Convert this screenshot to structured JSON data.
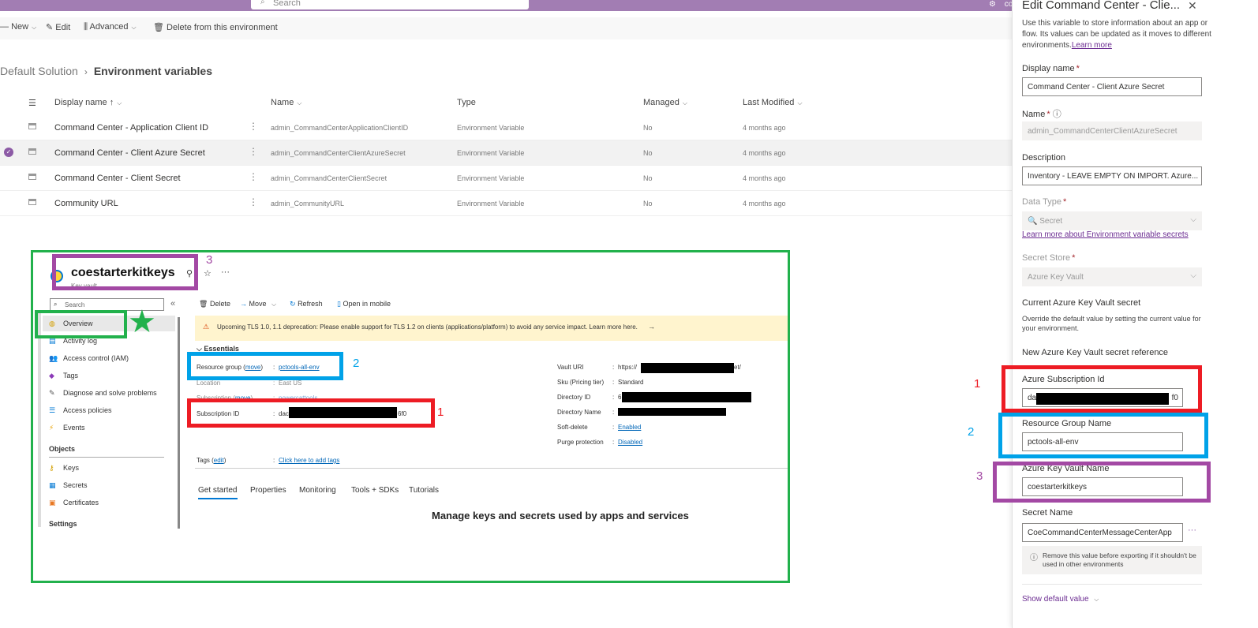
{
  "topbar": {
    "search_placeholder": "Search",
    "user_text": "coe-c"
  },
  "toolbar": {
    "new": "New",
    "edit": "Edit",
    "advanced": "Advanced",
    "delete": "Delete from this environment"
  },
  "breadcrumb": {
    "parent": "Default Solution",
    "current": "Environment variables"
  },
  "grid": {
    "headers": {
      "display_name": "Display name",
      "sort_arrow": "↑",
      "name": "Name",
      "type": "Type",
      "managed": "Managed",
      "last_modified": "Last Modified"
    },
    "rows": [
      {
        "display": "Command Center - Application Client ID",
        "name": "admin_CommandCenterApplicationClientID",
        "type": "Environment Variable",
        "managed": "No",
        "modified": "4 months ago"
      },
      {
        "display": "Command Center - Client Azure Secret",
        "name": "admin_CommandCenterClientAzureSecret",
        "type": "Environment Variable",
        "managed": "No",
        "modified": "4 months ago"
      },
      {
        "display": "Command Center - Client Secret",
        "name": "admin_CommandCenterClientSecret",
        "type": "Environment Variable",
        "managed": "No",
        "modified": "4 months ago"
      },
      {
        "display": "Community URL",
        "name": "admin_CommunityURL",
        "type": "Environment Variable",
        "managed": "No",
        "modified": "4 months ago"
      }
    ]
  },
  "azure": {
    "title": "coestarterkitkeys",
    "subtitle": "Key vault",
    "search_placeholder": "Search",
    "nav": [
      "Overview",
      "Activity log",
      "Access control (IAM)",
      "Tags",
      "Diagnose and solve problems",
      "Access policies",
      "Events"
    ],
    "objects_header": "Objects",
    "objects": [
      "Keys",
      "Secrets",
      "Certificates"
    ],
    "settings_header": "Settings",
    "cmd": {
      "delete": "Delete",
      "move": "Move",
      "refresh": "Refresh",
      "open_mobile": "Open in mobile"
    },
    "banner": "Upcoming TLS 1.0, 1.1 deprecation: Please enable support for TLS 1.2 on clients (applications/platform) to avoid any service impact. Learn more here.",
    "essentials": "Essentials",
    "left_props": [
      {
        "label": "Resource group",
        "move": "move",
        "value": "pctools-all-env"
      },
      {
        "label": "Location",
        "value": "East US"
      },
      {
        "label": "Subscription",
        "move": "move",
        "value": "powercattools"
      },
      {
        "label": "Subscription ID",
        "value_prefix": "dac",
        "value_suffix": "6f0"
      }
    ],
    "right_props": [
      {
        "label": "Vault URI",
        "value_prefix": "https://",
        "value_suffix": "et/"
      },
      {
        "label": "Sku (Pricing tier)",
        "value": "Standard"
      },
      {
        "label": "Directory ID",
        "value_prefix": "6"
      },
      {
        "label": "Directory Name",
        "value": ""
      },
      {
        "label": "Soft-delete",
        "value": "Enabled"
      },
      {
        "label": "Purge protection",
        "value": "Disabled"
      }
    ],
    "tags_label": "Tags",
    "tags_edit": "edit",
    "tags_value": "Click here to add tags",
    "tabs": [
      "Get started",
      "Properties",
      "Monitoring",
      "Tools + SDKs",
      "Tutorials"
    ],
    "tagline": "Manage keys and secrets used by apps and services"
  },
  "annotations": {
    "n1": "1",
    "n2": "2",
    "n3": "3"
  },
  "panel": {
    "title": "Edit Command Center - Clie...",
    "intro": "Use this variable to store information about an app or flow. Its values can be updated as it moves to different environments.",
    "learn_more": "Learn more",
    "display_name_label": "Display name",
    "display_name_value": "Command Center - Client Azure Secret",
    "name_label": "Name",
    "name_value": "admin_CommandCenterClientAzureSecret",
    "description_label": "Description",
    "description_value": "Inventory - LEAVE EMPTY ON IMPORT. Azure...",
    "data_type_label": "Data Type",
    "data_type_value": "Secret",
    "data_type_link": "Learn more about Environment variable secrets",
    "secret_store_label": "Secret Store",
    "secret_store_value": "Azure Key Vault",
    "current_header": "Current Azure Key Vault secret",
    "current_text": "Override the default value by setting the current value for your environment.",
    "new_ref_header": "New Azure Key Vault secret reference",
    "sub_id_label": "Azure Subscription Id",
    "sub_id_prefix": "da",
    "sub_id_suffix": "f0",
    "rg_label": "Resource Group Name",
    "rg_value": "pctools-all-env",
    "kv_label": "Azure Key Vault Name",
    "kv_value": "coestarterkitkeys",
    "secret_name_label": "Secret Name",
    "secret_name_value": "CoeCommandCenterMessageCenterApp",
    "remove_note": "Remove this value before exporting if it shouldn't be used in other environments",
    "show_default": "Show default value"
  },
  "colors": {
    "purple_bar": "#a27db3",
    "green": "#22b14c",
    "red": "#ed1c24",
    "blue": "#00a2e8",
    "purple_box": "#a349a4"
  }
}
